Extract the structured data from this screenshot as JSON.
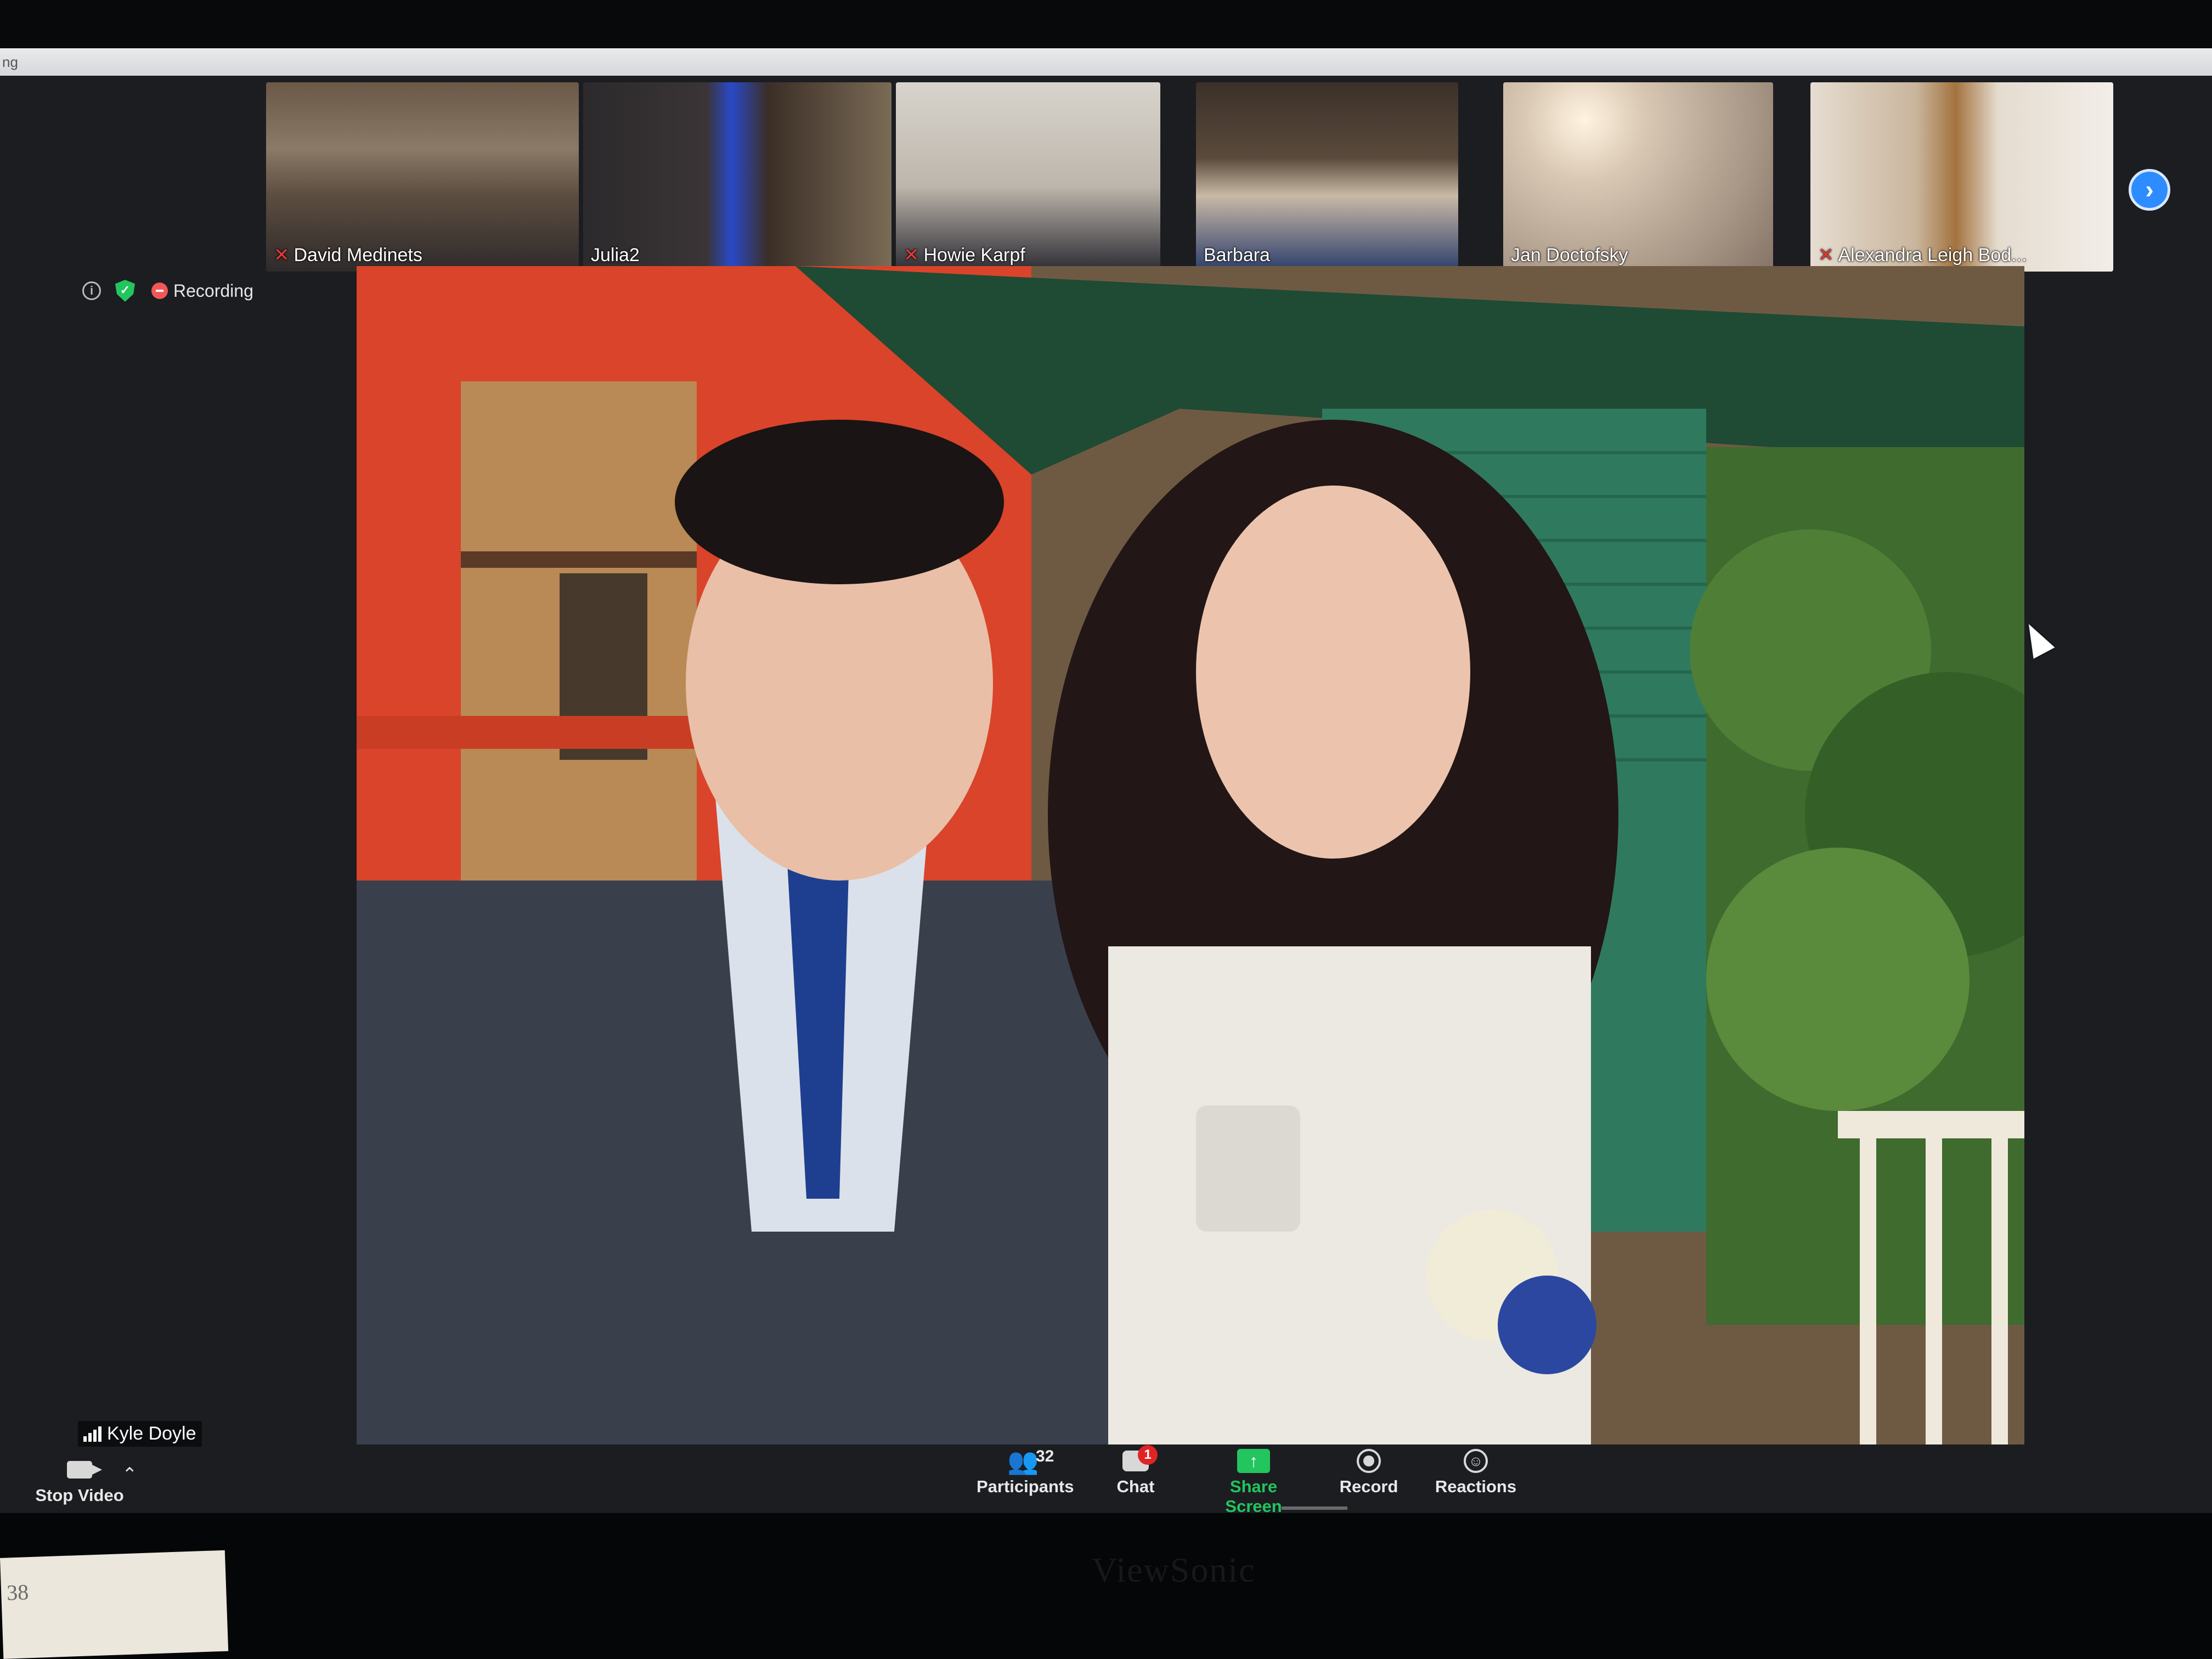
{
  "window": {
    "title": "ng"
  },
  "participants_strip": [
    {
      "name": "David Medinets",
      "muted": true
    },
    {
      "name": "Julia2",
      "muted": false
    },
    {
      "name": "Howie Karpf",
      "muted": true
    },
    {
      "name": "Barbara",
      "muted": false
    },
    {
      "name": "Jan Doctofsky",
      "muted": false
    },
    {
      "name": "Alexandra Leigh Bod...",
      "muted": true
    }
  ],
  "strip_next_icon": "chevron-right-icon",
  "status": {
    "recording_label": "Recording"
  },
  "active_speaker": {
    "name": "Kyle Doyle"
  },
  "toolbar": {
    "stop_video": "Stop Video",
    "participants": "Participants",
    "participants_count": "32",
    "chat": "Chat",
    "chat_badge": "1",
    "share_screen": "Share Screen",
    "record": "Record",
    "reactions": "Reactions"
  },
  "monitor": {
    "brand": "ViewSonic"
  },
  "desk_note": {
    "text": "38"
  },
  "colors": {
    "accent_blue": "#2d8cff",
    "share_green": "#22c55e",
    "mute_red": "#e53935"
  }
}
